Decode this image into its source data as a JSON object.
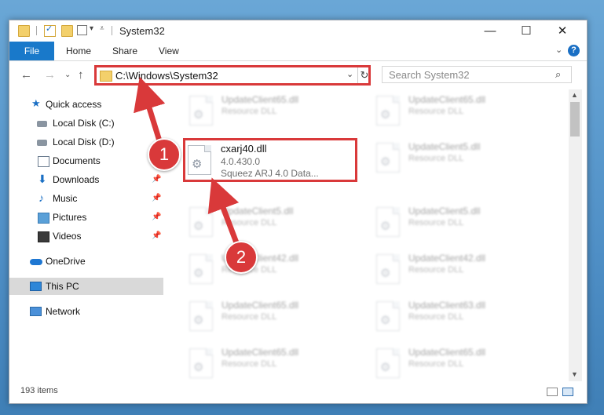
{
  "window": {
    "title": "System32",
    "controls": {
      "minimize": "—",
      "maximize": "☐",
      "close": "✕"
    }
  },
  "ribbon": {
    "file_label": "File",
    "tabs": [
      "Home",
      "Share",
      "View"
    ],
    "help_label": "?"
  },
  "address": {
    "path": "C:\\Windows\\System32",
    "search_placeholder": "Search System32"
  },
  "nav": {
    "quick_access": "Quick access",
    "items": [
      {
        "label": "Local Disk (C:)",
        "icon": "drive-icon",
        "pinned": false
      },
      {
        "label": "Local Disk (D:)",
        "icon": "drive-icon",
        "pinned": false
      },
      {
        "label": "Documents",
        "icon": "documents-icon",
        "pinned": true
      },
      {
        "label": "Downloads",
        "icon": "downloads-icon",
        "pinned": true
      },
      {
        "label": "Music",
        "icon": "music-icon",
        "pinned": true
      },
      {
        "label": "Pictures",
        "icon": "pictures-icon",
        "pinned": true
      },
      {
        "label": "Videos",
        "icon": "videos-icon",
        "pinned": true
      }
    ],
    "onedrive": "OneDrive",
    "this_pc": "This PC",
    "network": "Network"
  },
  "files": {
    "highlighted": {
      "name": "cxarj40.dll",
      "version": "4.0.430.0",
      "description": "Squeez ARJ 4.0 Data..."
    },
    "left_column": [
      {
        "name": "UpdateClient65.dll",
        "type": "Resource DLL"
      },
      {
        "name": "UpdateClient5.dll",
        "type": "Resource DLL"
      },
      {
        "name": "UpdateClient42.dll",
        "type": "Resource DLL"
      },
      {
        "name": "UpdateClient65.dll",
        "type": "Resource DLL"
      },
      {
        "name": "UpdateClient65.dll",
        "type": "Resource DLL"
      }
    ],
    "right_column": [
      {
        "name": "UpdateClient65.dll",
        "type": "Resource DLL"
      },
      {
        "name": "UpdateClient5.dll",
        "type": "Resource DLL"
      },
      {
        "name": "UpdateClient5.dll",
        "type": "Resource DLL"
      },
      {
        "name": "UpdateClient42.dll",
        "type": "Resource DLL"
      },
      {
        "name": "UpdateClient63.dll",
        "type": "Resource DLL"
      },
      {
        "name": "UpdateClient65.dll",
        "type": "Resource DLL"
      }
    ]
  },
  "status": {
    "item_count": "193 items"
  },
  "annotations": {
    "step1": "1",
    "step2": "2",
    "color": "#d9393a"
  }
}
